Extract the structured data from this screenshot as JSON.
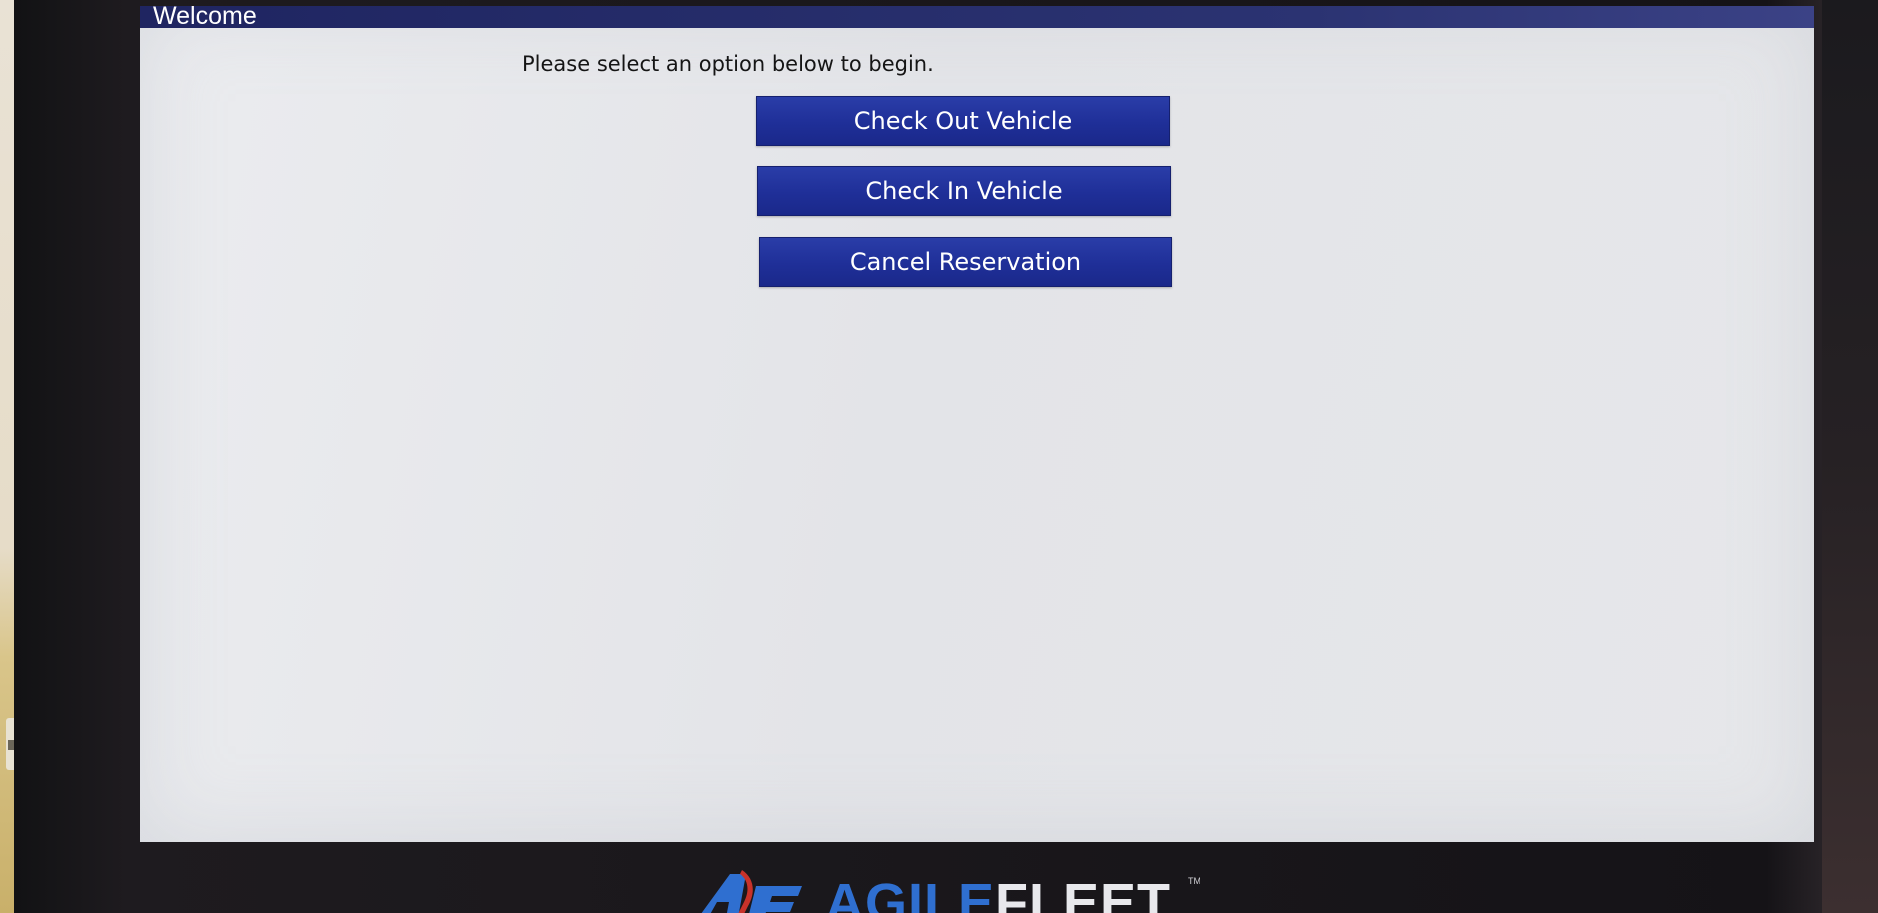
{
  "window": {
    "title": "Welcome"
  },
  "main": {
    "instruction": "Please select an option below to begin.",
    "buttons": [
      {
        "label": "Check Out Vehicle"
      },
      {
        "label": "Check In Vehicle"
      },
      {
        "label": "Cancel Reservation"
      }
    ]
  },
  "branding": {
    "logo_text_primary": "AGILE",
    "logo_text_secondary": "FLEET",
    "trademark": "TM",
    "brand_blue": "#2f6fd0",
    "brand_red": "#c8322a"
  },
  "colors": {
    "title_bar": "#1f2561",
    "button": "#1f2f98",
    "screen_background": "#e5e6e9"
  }
}
